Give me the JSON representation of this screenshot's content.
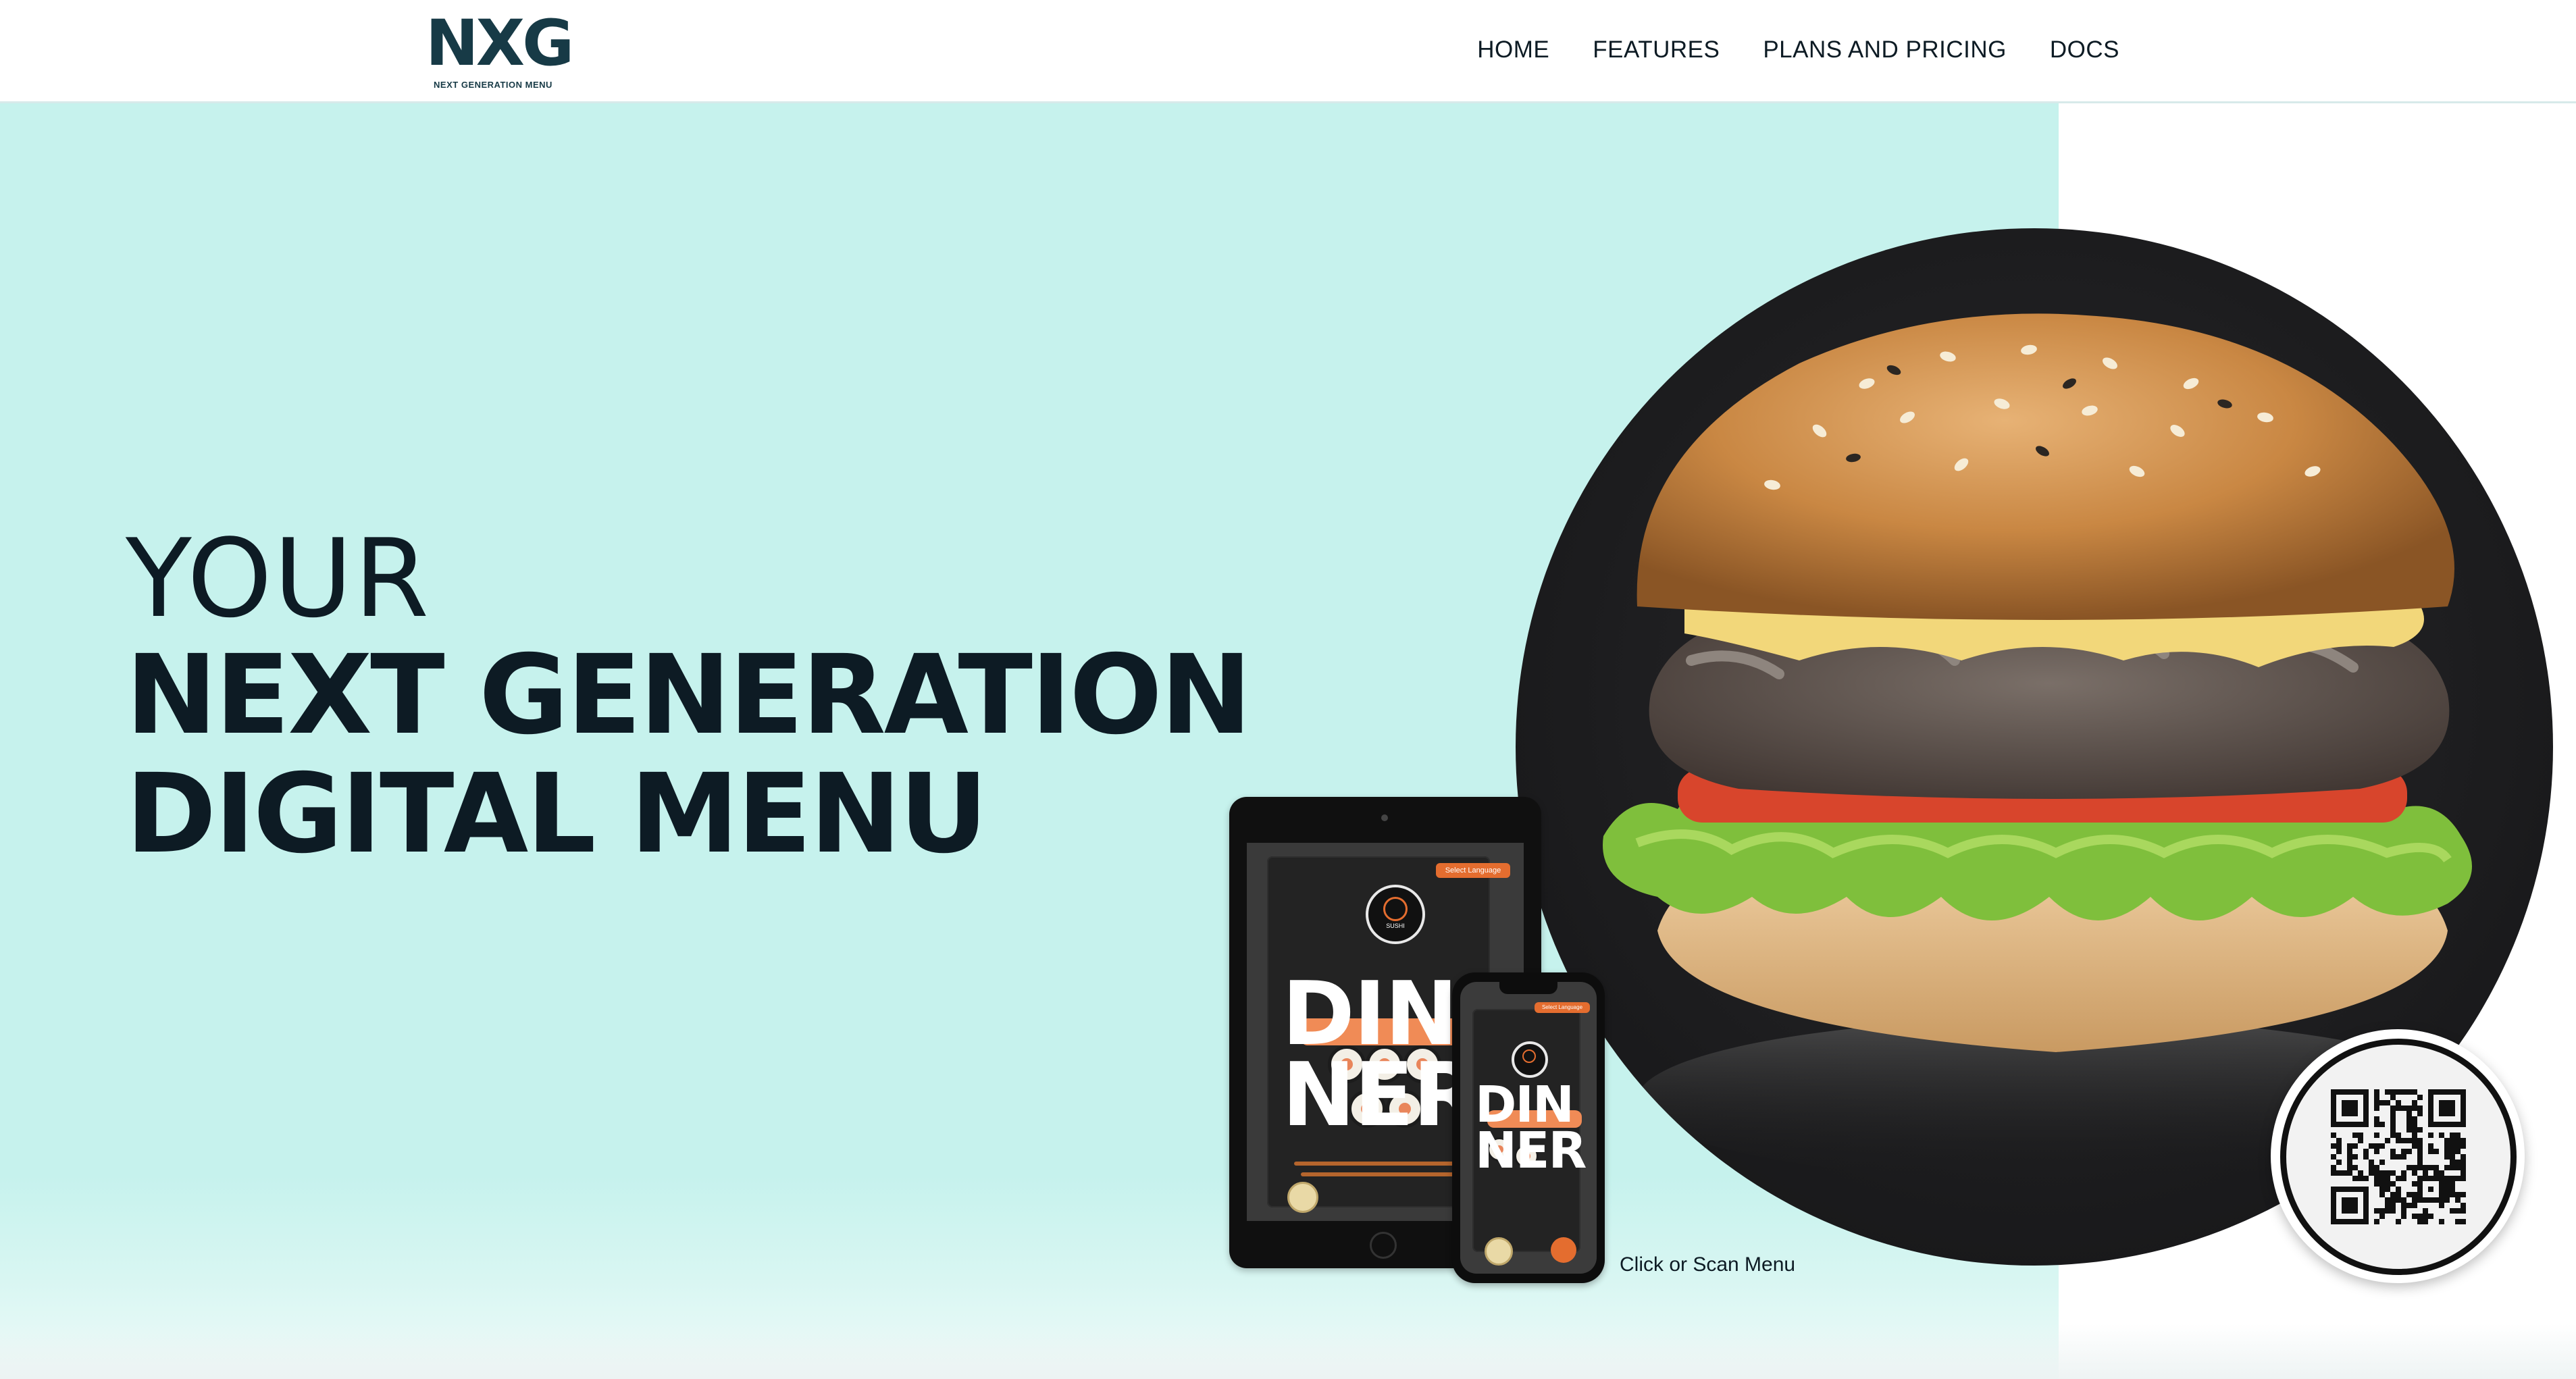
{
  "brand": {
    "logo_mark": "NXG",
    "logo_subtitle": "NEXT GENERATION MENU"
  },
  "nav": {
    "items": [
      "HOME",
      "FEATURES",
      "PLANS AND PRICING",
      "DOCS"
    ]
  },
  "hero": {
    "line1": "YOUR",
    "line2": "NEXT GENERATION",
    "line3": "DIGITAL MENU",
    "caption": "Click or Scan Menu"
  },
  "menu_preview": {
    "language_button": "Select Language",
    "badge_label": "SUSHI",
    "tablet_dinner": [
      "DIN",
      "NER"
    ],
    "phone_dinner": [
      "DIN",
      "NER"
    ]
  },
  "colors": {
    "hero_background": "#c6f2ed",
    "text_dark": "#0d1b24",
    "logo_teal": "#2e8e90",
    "accent_orange": "#e46d2f"
  },
  "icons": [
    "logo-icon",
    "food-photo-burger",
    "qr-code-icon",
    "tablet-device",
    "phone-device"
  ]
}
